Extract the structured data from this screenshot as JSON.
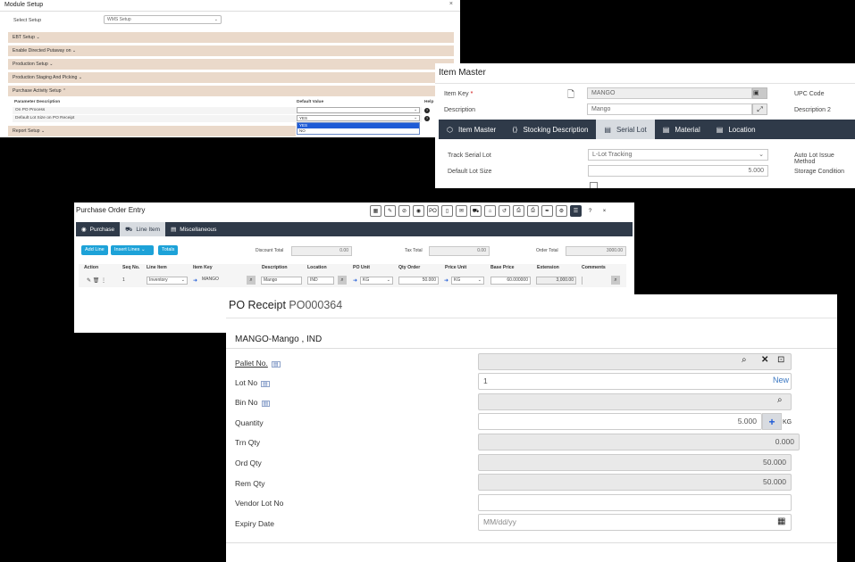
{
  "module_setup": {
    "title": "Module Setup",
    "close": "×",
    "select_setup_label": "Select Setup",
    "select_setup_value": "WMS Setup",
    "sections": [
      "EBT Setup",
      "Enable Directed Putaway on",
      "Production Setup",
      "Production Staging And Picking",
      "Purchase Activity Setup"
    ],
    "param_header": "Parameter Description",
    "default_header": "Default Value",
    "help_header": "Help",
    "params": [
      {
        "label": "On PO Process",
        "value": ""
      },
      {
        "label": "Default Lot Size on PO Receipt",
        "value": "YES"
      }
    ],
    "dropdown_options": [
      "YES",
      "NO"
    ],
    "report_setup": "Report Setup"
  },
  "item_master": {
    "title": "Item Master",
    "item_key_label": "Item Key",
    "item_key_value": "MANGO",
    "description_label": "Description",
    "description_value": "Mango",
    "upc_label": "UPC Code",
    "description2_label": "Description 2",
    "tabs": [
      "Item Master",
      "Stocking Description",
      "Serial Lot",
      "Material",
      "Location"
    ],
    "active_tab": "Serial Lot",
    "track_serial_lot_label": "Track Serial Lot",
    "track_serial_lot_value": "L-Lot Tracking",
    "auto_lot_label": "Auto Lot Issue Method",
    "default_lot_size_label": "Default Lot Size",
    "default_lot_size_value": "5.000",
    "storage_condition_label": "Storage Condition"
  },
  "po_entry": {
    "title": "Purchase Order Entry",
    "tabs": [
      "Purchase",
      "Line Item",
      "Miscellaneous"
    ],
    "active_tab": "Line Item",
    "buttons": [
      "Add Line",
      "Insert Lines",
      "Totals"
    ],
    "discount_total_label": "Discount Total",
    "discount_total_value": "0.00",
    "tax_total_label": "Tax Total",
    "tax_total_value": "0.00",
    "order_total_label": "Order Total",
    "order_total_value": "3000.00",
    "columns": [
      "Action",
      "Seq No.",
      "Line Item",
      "Item Key",
      "Description",
      "Location",
      "PO Unit",
      "Qty Order",
      "Price Unit",
      "Base Price",
      "Extension",
      "Comments"
    ],
    "row": {
      "seq": "1",
      "line_item": "Inventory",
      "item_key": "MANGO",
      "description": "Mango",
      "location": "IND",
      "po_unit": "KG",
      "qty_order": "50.000",
      "price_unit": "KG",
      "base_price": "60.000000",
      "extension": "3,000.00"
    },
    "toolbar_po": "PO",
    "help": "?",
    "close": "×"
  },
  "po_receipt": {
    "title": "PO Receipt",
    "po_number": "PO000364",
    "item_header": "MANGO-Mango , IND",
    "fields": {
      "pallet_no": {
        "label": "Pallet No.",
        "value": ""
      },
      "lot_no": {
        "label": "Lot No",
        "value": "1",
        "link": "New"
      },
      "bin_no": {
        "label": "Bin No",
        "value": ""
      },
      "quantity": {
        "label": "Quantity",
        "value": "5.000",
        "unit": "KG"
      },
      "trn_qty": {
        "label": "Trn Qty",
        "value": "0.000"
      },
      "ord_qty": {
        "label": "Ord Qty",
        "value": "50.000"
      },
      "rem_qty": {
        "label": "Rem Qty",
        "value": "50.000"
      },
      "vendor_lot_no": {
        "label": "Vendor Lot No",
        "value": ""
      },
      "expiry_date": {
        "label": "Expiry Date",
        "placeholder": "MM/dd/yy"
      }
    }
  },
  "colors": {
    "nav_dark": "#2f3a49",
    "section_bg": "#ead9ca",
    "accent_blue": "#1da2d8",
    "link_blue": "#3b78c2"
  }
}
